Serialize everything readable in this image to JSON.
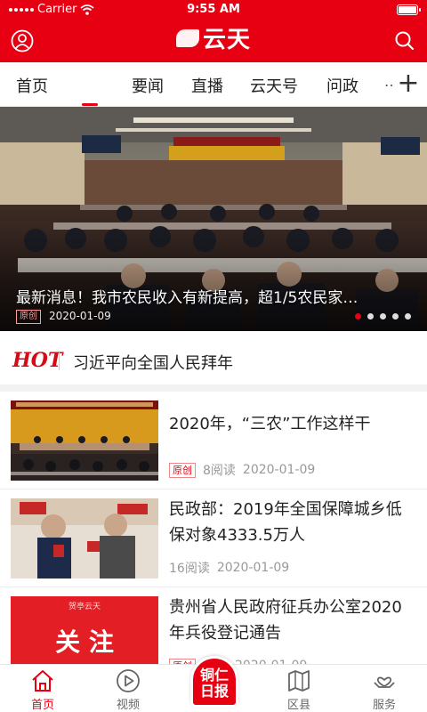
{
  "status_bar": {
    "carrier": "Carrier",
    "time": "9:55 AM"
  },
  "header": {
    "logo_text": "云天",
    "colors": {
      "brand": "#e60012"
    }
  },
  "tabs": [
    {
      "label": "首页"
    },
    {
      "label": "要闻"
    },
    {
      "label": "直播"
    },
    {
      "label": "云天号"
    },
    {
      "label": "问政"
    }
  ],
  "tabs_more": "…",
  "plus_label": "+",
  "banner": {
    "caption": "最新消息！我市农民收入有新提高，超1/5农民家…",
    "tag": "原创",
    "date": "2020-01-09",
    "dots_total": 5,
    "active_dot": 1
  },
  "hot": {
    "label": "HOT",
    "headline": "习近平向全国人民拜年"
  },
  "news": [
    {
      "title": "2020年，“三农”工作这样干",
      "tag": "原创",
      "reads": "8阅读",
      "date": "2020-01-09"
    },
    {
      "title": "民政部：2019年全国保障城乡低保对象4333.5万人",
      "tag": "",
      "reads": "16阅读",
      "date": "2020-01-09"
    },
    {
      "title": "贵州省人民政府征兵办公室2020年兵役登记通告",
      "tag": "原创",
      "reads": "阅读",
      "date": "2020-01-09",
      "thumb_text": "关 注",
      "thumb_small": "贺亭云天"
    }
  ],
  "bottom_nav": {
    "items": [
      {
        "label": "首页"
      },
      {
        "label": "视频"
      },
      {
        "label": "区县"
      },
      {
        "label": "服务"
      }
    ],
    "center_line1": "铜仁",
    "center_line2": "日报"
  }
}
